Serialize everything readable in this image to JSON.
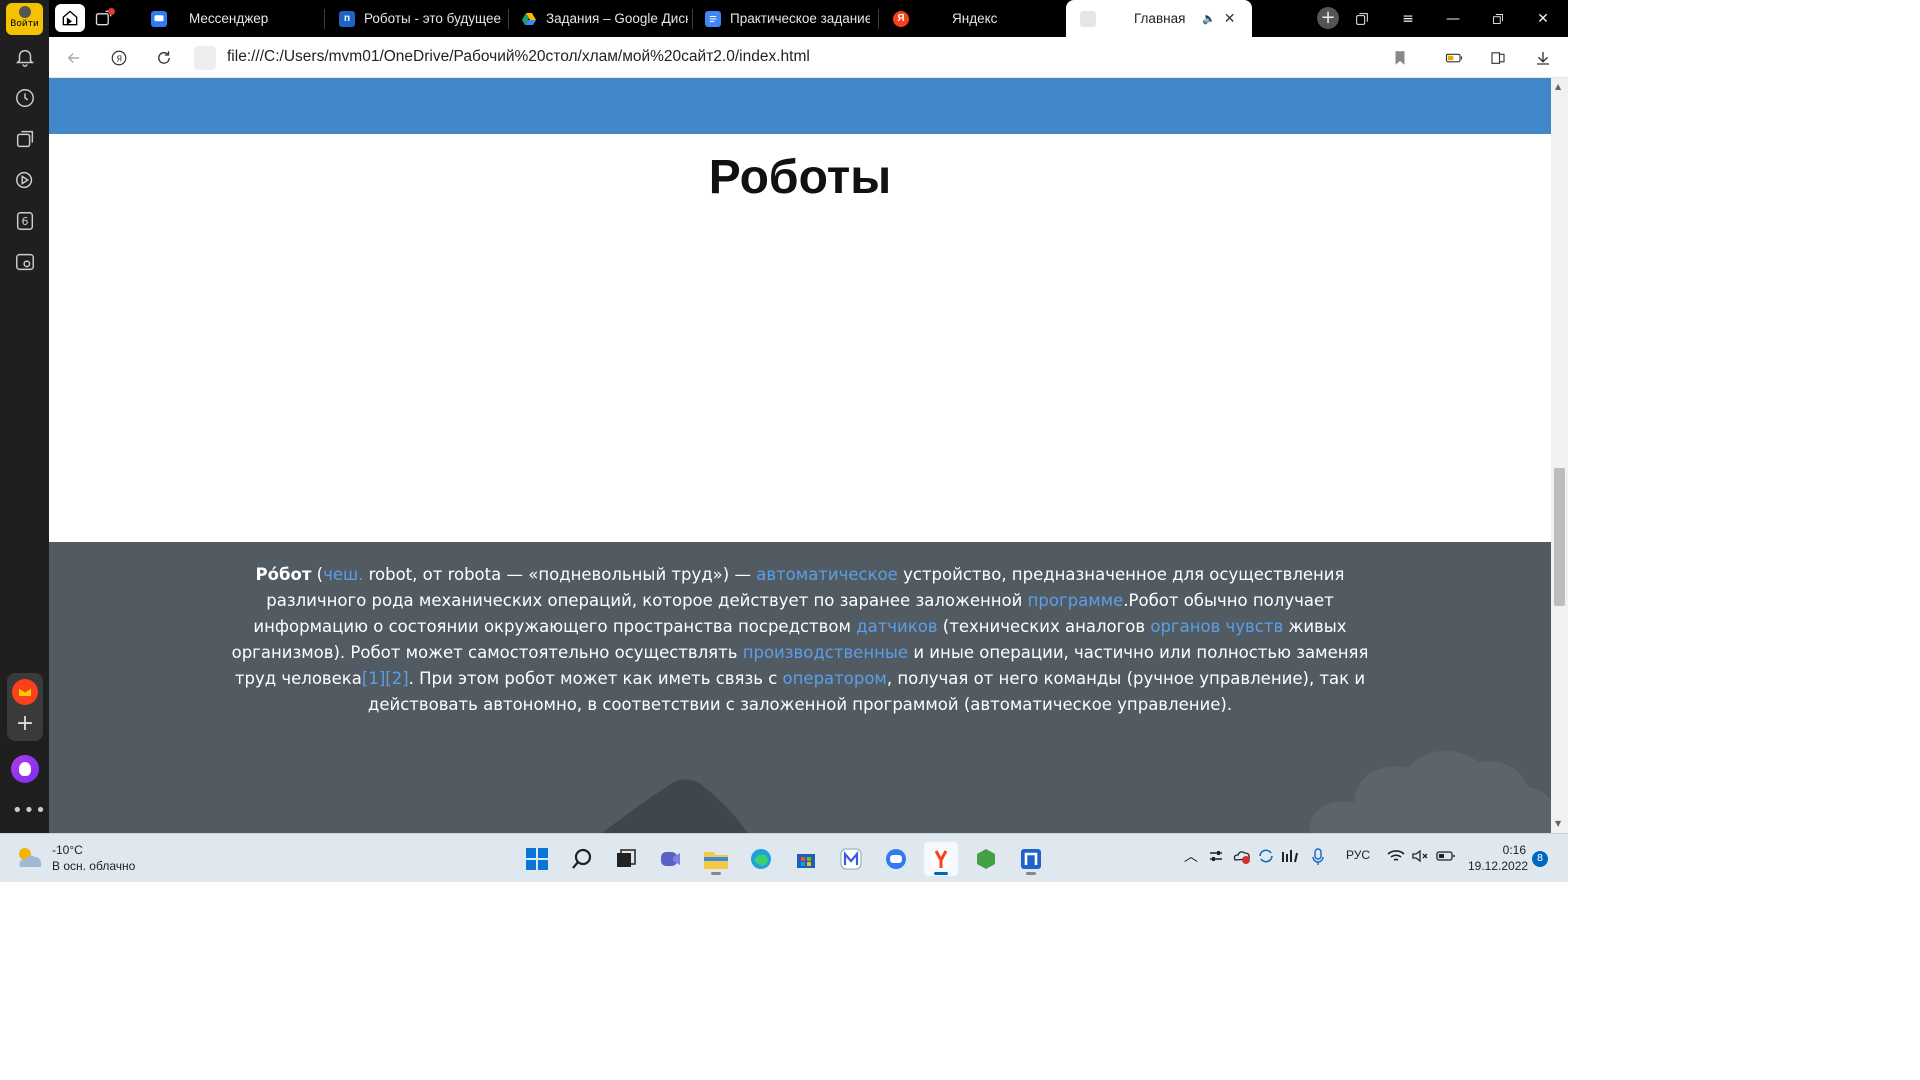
{
  "sidebar": {
    "login_label": "Войти",
    "tab_count": "6"
  },
  "tabs": [
    {
      "title": "Мессенджер",
      "color": "#2f7bf6",
      "glyph": ""
    },
    {
      "title": "Роботы - это будущее",
      "color": "#1e64c8",
      "glyph": "n"
    },
    {
      "title": "Задания – Google Диск",
      "color": "#1fa463",
      "glyph": ""
    },
    {
      "title": "Практическое задание",
      "color": "#4285f4",
      "glyph": ""
    },
    {
      "title": "Яндекс",
      "color": "#fc3f1d",
      "glyph": "Я"
    },
    {
      "title": "Главная",
      "color": "#cccccc",
      "glyph": ""
    }
  ],
  "address": {
    "url": "file:///C:/Users/mvm01/OneDrive/Рабочий%20стол/хлам/мой%20сайт2.0/index.html"
  },
  "page": {
    "heading": "Роботы",
    "para": {
      "term": "Ро́бот",
      "t1": " (",
      "l1": "чеш.",
      "t2": " robot, от robota — «подневольный труд») — ",
      "l2": "автоматическое",
      "t3": " устройство, предназначенное для осуществления различного рода механических операций, которое действует по заранее заложенной ",
      "l3": "программе",
      "t4": ".Робот обычно получает информацию о состоянии окружающего пространства посредством ",
      "l4": "датчиков",
      "t5": " (технических аналогов ",
      "l5": "органов чувств",
      "t6": " живых организмов). Робот может самостоятельно осуществлять ",
      "l6": "производственные",
      "t7": " и иные операции, частично или полностью заменяя труд человека",
      "l7": "[1]",
      "l8": "[2]",
      "t8": ". При этом робот может как иметь связь с ",
      "l9": "оператором",
      "t9": ", получая от него команды (ручное управление), так и действовать автономно, в соответствии с заложенной программой (автоматическое управление)."
    }
  },
  "taskbar": {
    "temperature": "-10°C",
    "weather_desc": "В осн. облачно",
    "language": "РУС",
    "time": "0:16",
    "date": "19.12.2022",
    "notifications": "8"
  },
  "colors": {
    "banner": "#4287c9",
    "content_bg": "#535b62",
    "link": "#5b9ee8"
  }
}
